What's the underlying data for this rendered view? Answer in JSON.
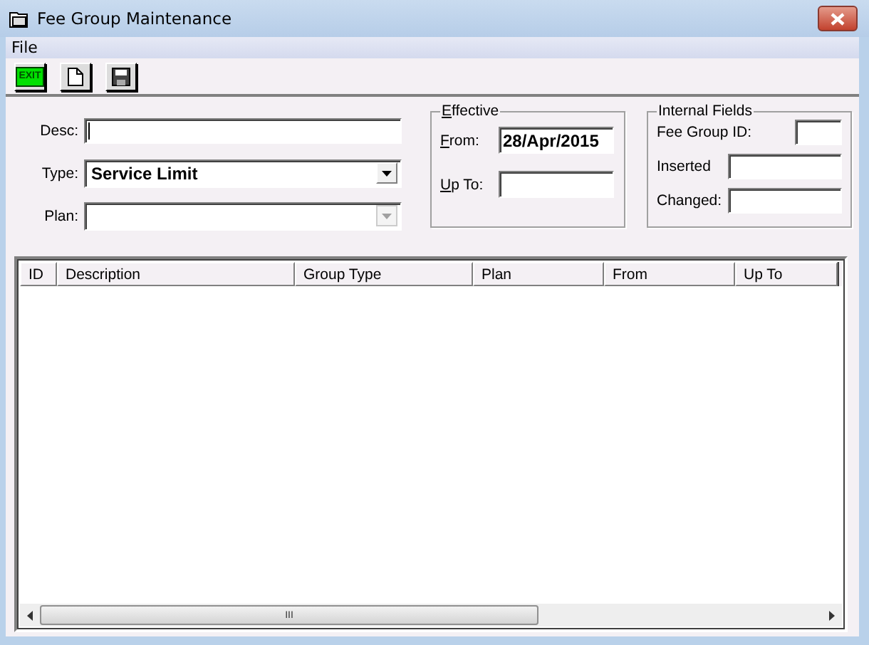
{
  "window": {
    "title": "Fee Group Maintenance"
  },
  "menu": [
    {
      "label": "File"
    }
  ],
  "toolbar": [
    {
      "kind": "exit",
      "label": "EXIT"
    },
    {
      "kind": "new"
    },
    {
      "kind": "save"
    }
  ],
  "form": {
    "desc": {
      "label": "Desc:"
    },
    "type": {
      "label": "Type:",
      "value": "Service Limit",
      "disabled": false
    },
    "plan": {
      "label": "Plan:",
      "disabled": true
    }
  },
  "effective": {
    "title": "Effective",
    "mnemonic": true,
    "fields": [
      {
        "label": "From:",
        "mnemonic": true,
        "value": "28/Apr/2015"
      },
      {
        "label": "Up To:",
        "mnemonic": true
      }
    ]
  },
  "internal": {
    "title": "Internal Fields",
    "fields": [
      {
        "label": "Fee Group ID:",
        "kind": "short"
      },
      {
        "label": "Inserted",
        "kind": "wide"
      },
      {
        "label": "Changed:",
        "kind": "wide"
      }
    ]
  },
  "table": {
    "columns": [
      "ID",
      "Description",
      "Group Type",
      "Plan",
      "From",
      "Up To"
    ],
    "thumb": "III"
  }
}
